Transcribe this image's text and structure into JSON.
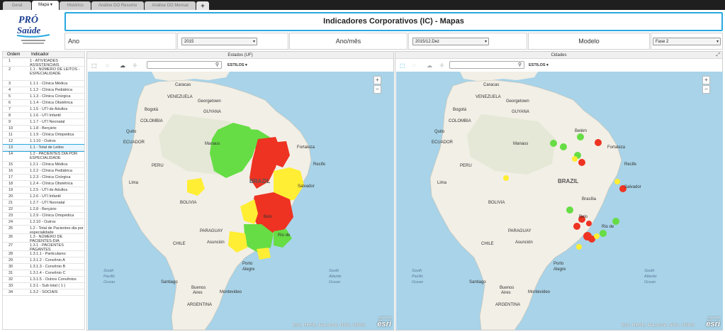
{
  "tabs": [
    {
      "label": "Geral"
    },
    {
      "label": "Mapa ▾"
    },
    {
      "label": "Histórico"
    },
    {
      "label": "Análise DO Resumo"
    },
    {
      "label": "Análise DO Mensal"
    },
    {
      "label": "+"
    }
  ],
  "logo": {
    "text": "PRÓ Saúde",
    "tagline": "Associação Beneficente de Assistência Social e Hospitalar"
  },
  "header": {
    "title": "Indicadores Corporativos (IC) - Mapas"
  },
  "filters": {
    "ano_label": "Ano",
    "ano_value": "2015",
    "anomes_label": "Ano/mês",
    "anomes_value": "2015/12.Dez",
    "modelo_label": "Modelo",
    "modelo_value": "Fase 2"
  },
  "table": {
    "col_ordem": "Ordem",
    "col_indicador": "Indicador",
    "rows": [
      {
        "ordem": "1",
        "indicador": "1 - ATIVIDADES ASSISTENCIAIS"
      },
      {
        "ordem": "2",
        "indicador": "1.1 - NÚMERO DE LEITOS - ESPECIALIDADE"
      },
      {
        "ordem": "3",
        "indicador": "1.1.1 - Clínica Médica"
      },
      {
        "ordem": "4",
        "indicador": "1.1.2 - Clínica Pediátrica"
      },
      {
        "ordem": "5",
        "indicador": "1.1.3 - Clínica Cirúrgica"
      },
      {
        "ordem": "6",
        "indicador": "1.1.4 - Clínica Obstétrica"
      },
      {
        "ordem": "7",
        "indicador": "1.1.5 - UTI de Adultos"
      },
      {
        "ordem": "8",
        "indicador": "1.1.6 - UTI Infantil"
      },
      {
        "ordem": "9",
        "indicador": "1.1.7 - UTI Neonatal"
      },
      {
        "ordem": "10",
        "indicador": "1.1.8 - Berçário"
      },
      {
        "ordem": "11",
        "indicador": "1.1.9 - Clínica Ortopédica"
      },
      {
        "ordem": "12",
        "indicador": "1.1.10 - Outros"
      },
      {
        "ordem": "13",
        "indicador": "1.1 - Total de Leitos"
      },
      {
        "ordem": "14",
        "indicador": "1.2 - PACIENTES DIA POR ESPECIALIDADE"
      },
      {
        "ordem": "15",
        "indicador": "1.2.1 - Clínica Médica"
      },
      {
        "ordem": "16",
        "indicador": "1.2.2 - Clínica Pediátrica"
      },
      {
        "ordem": "17",
        "indicador": "1.2.3 - Clínica Cirúrgica"
      },
      {
        "ordem": "18",
        "indicador": "1.2.4 - Clínica Obstétrica"
      },
      {
        "ordem": "19",
        "indicador": "1.2.5 - UTI de Adultos"
      },
      {
        "ordem": "20",
        "indicador": "1.2.6 - UTI Infantil"
      },
      {
        "ordem": "21",
        "indicador": "1.2.7 - UTI Neonatal"
      },
      {
        "ordem": "22",
        "indicador": "1.2.8 - Berçário"
      },
      {
        "ordem": "23",
        "indicador": "1.2.9 - Clínica Ortopédica"
      },
      {
        "ordem": "24",
        "indicador": "1.2.10 - Outros"
      },
      {
        "ordem": "25",
        "indicador": "1.2 - Total de Pacientes dia por especialidade"
      },
      {
        "ordem": "26",
        "indicador": "1.3 - NÚMERO DE PACIENTES-DIA"
      },
      {
        "ordem": "27",
        "indicador": "1.3.1 - PACIENTES PAGANTES"
      },
      {
        "ordem": "28",
        "indicador": "1.3.1.1 - Particulares"
      },
      {
        "ordem": "29",
        "indicador": "1.3.1.2 - Convênio A"
      },
      {
        "ordem": "30",
        "indicador": "1.3.1.3 - Convênio B"
      },
      {
        "ordem": "31",
        "indicador": "1.3.1.4 - Convênio C"
      },
      {
        "ordem": "32",
        "indicador": "1.3.1.5 - Outros Convênios"
      },
      {
        "ordem": "33",
        "indicador": "1.3.1 - Sub total ( 1 )"
      },
      {
        "ordem": "34",
        "indicador": "1.3.2 - SOCIAIS"
      }
    ]
  },
  "map_left": {
    "title": "Estados (UF)",
    "styles_label": "ESTILOS ▾",
    "attribution": "Esri, HERE, DeLorme, NGA, USGS",
    "esri_powered": "POWERED BY",
    "esri_logo": "esri",
    "labels": {
      "caracas": "Caracas",
      "venezuela": "VENEZUELA",
      "bogota": "Bogotá",
      "georgetown": "Georgetown",
      "guyana": "GUYANA",
      "colombia": "COLOMBIA",
      "quito": "Quito",
      "ecuador": "ECUADOR",
      "manaus": "Manaus",
      "fortaleza": "Fortaleza",
      "recife": "Recife",
      "peru": "PERU",
      "lima": "Lima",
      "brazil": "BRAZIL",
      "salvador": "Salvador",
      "bolivia": "BOLIVIA",
      "belo": "Belo",
      "rio": "Rio de",
      "paraguay": "PARAGUAY",
      "asuncion": "Asunción",
      "chile": "CHILE",
      "porto": "Porto",
      "alegre": "Alegre",
      "santiago": "Santiago",
      "buenosaires": "Buenos",
      "aires": "Aires",
      "montevideo": "Montevideo",
      "argentina": "ARGENTINA",
      "southpacific": "South",
      "pacific": "Pacific",
      "ocean": "Ocean",
      "southatlantic": "South",
      "atlantic": "Atlantic",
      "ocean2": "Ocean"
    }
  },
  "map_right": {
    "title": "Cidades",
    "styles_label": "ESTILOS ▾",
    "attribution": "Esri, HERE, DeLorme, NGA, USGS",
    "esri_powered": "POWERED BY",
    "esri_logo": "esri",
    "labels": {
      "caracas": "Caracas",
      "venezuela": "VENEZUELA",
      "bogota": "Bogotá",
      "georgetown": "Georgetown",
      "guyana": "GUYANA",
      "colombia": "COLOMBIA",
      "quito": "Quito",
      "ecuador": "ECUADOR",
      "manaus": "Manaus",
      "belem": "Belém",
      "fortaleza": "Fortaleza",
      "recife": "Recife",
      "peru": "PERU",
      "lima": "Lima",
      "brazil": "BRAZIL",
      "brasilia": "Brasília",
      "salvador": "Salvador",
      "bolivia": "BOLIVIA",
      "belo": "Belo",
      "rio": "Rio de",
      "paraguay": "PARAGUAY",
      "asuncion": "Asunción",
      "chile": "CHILE",
      "porto": "Porto",
      "alegre": "Alegre",
      "santiago": "Santiago",
      "buenosaires": "Buenos",
      "aires": "Aires",
      "montevideo": "Montevideo",
      "argentina": "ARGENTINA",
      "southpacific": "South",
      "pacific": "Pacific",
      "ocean": "Ocean",
      "southatlantic": "South",
      "atlantic": "Atlantic",
      "ocean2": "Ocean"
    }
  },
  "colors": {
    "green": "#66dd44",
    "yellow": "#ffee33",
    "red": "#ee3322",
    "accent": "#29a9e0",
    "ocean": "#a8d3e8",
    "land": "#f2efe6"
  }
}
